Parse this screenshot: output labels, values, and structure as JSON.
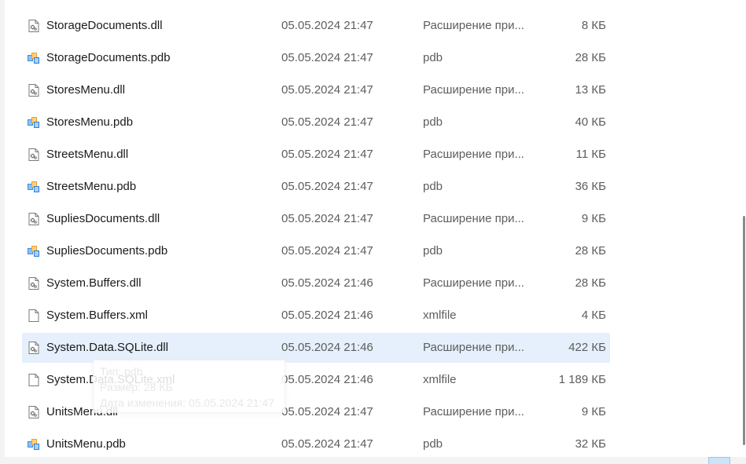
{
  "files": [
    {
      "name": "StorageDocuments.dll",
      "date": "05.05.2024 21:47",
      "type": "Расширение при...",
      "size": "8 КБ",
      "icon": "dll-icon",
      "selected": false
    },
    {
      "name": "StorageDocuments.pdb",
      "date": "05.05.2024 21:47",
      "type": "pdb",
      "size": "28 КБ",
      "icon": "pdb-icon",
      "selected": false
    },
    {
      "name": "StoresMenu.dll",
      "date": "05.05.2024 21:47",
      "type": "Расширение при...",
      "size": "13 КБ",
      "icon": "dll-icon",
      "selected": false
    },
    {
      "name": "StoresMenu.pdb",
      "date": "05.05.2024 21:47",
      "type": "pdb",
      "size": "40 КБ",
      "icon": "pdb-icon",
      "selected": false
    },
    {
      "name": "StreetsMenu.dll",
      "date": "05.05.2024 21:47",
      "type": "Расширение при...",
      "size": "11 КБ",
      "icon": "dll-icon",
      "selected": false
    },
    {
      "name": "StreetsMenu.pdb",
      "date": "05.05.2024 21:47",
      "type": "pdb",
      "size": "36 КБ",
      "icon": "pdb-icon",
      "selected": false
    },
    {
      "name": "SupliesDocuments.dll",
      "date": "05.05.2024 21:47",
      "type": "Расширение при...",
      "size": "9 КБ",
      "icon": "dll-icon",
      "selected": false
    },
    {
      "name": "SupliesDocuments.pdb",
      "date": "05.05.2024 21:47",
      "type": "pdb",
      "size": "28 КБ",
      "icon": "pdb-icon",
      "selected": false
    },
    {
      "name": "System.Buffers.dll",
      "date": "05.05.2024 21:46",
      "type": "Расширение при...",
      "size": "28 КБ",
      "icon": "dll-icon",
      "selected": false
    },
    {
      "name": "System.Buffers.xml",
      "date": "05.05.2024 21:46",
      "type": "xmlfile",
      "size": "4 КБ",
      "icon": "file-icon",
      "selected": false
    },
    {
      "name": "System.Data.SQLite.dll",
      "date": "05.05.2024 21:46",
      "type": "Расширение при...",
      "size": "422 КБ",
      "icon": "dll-icon",
      "selected": true
    },
    {
      "name": "System.Data.SQLite.xml",
      "date": "05.05.2024 21:46",
      "type": "xmlfile",
      "size": "1 189 КБ",
      "icon": "file-icon",
      "selected": false
    },
    {
      "name": "UnitsMenu.dll",
      "date": "05.05.2024 21:47",
      "type": "Расширение при...",
      "size": "9 КБ",
      "icon": "dll-icon",
      "selected": false
    },
    {
      "name": "UnitsMenu.pdb",
      "date": "05.05.2024 21:47",
      "type": "pdb",
      "size": "32 КБ",
      "icon": "pdb-icon",
      "selected": false
    }
  ],
  "tooltip": {
    "type_line": "Тип: pdb",
    "size_line": "Размер: 28 КБ",
    "date_line": "Дата изменения: 05.05.2024 21:47"
  },
  "colors": {
    "selection": "#e5f0fc",
    "text": "#1a1a1a",
    "secondary_text": "#5d5d5d"
  }
}
